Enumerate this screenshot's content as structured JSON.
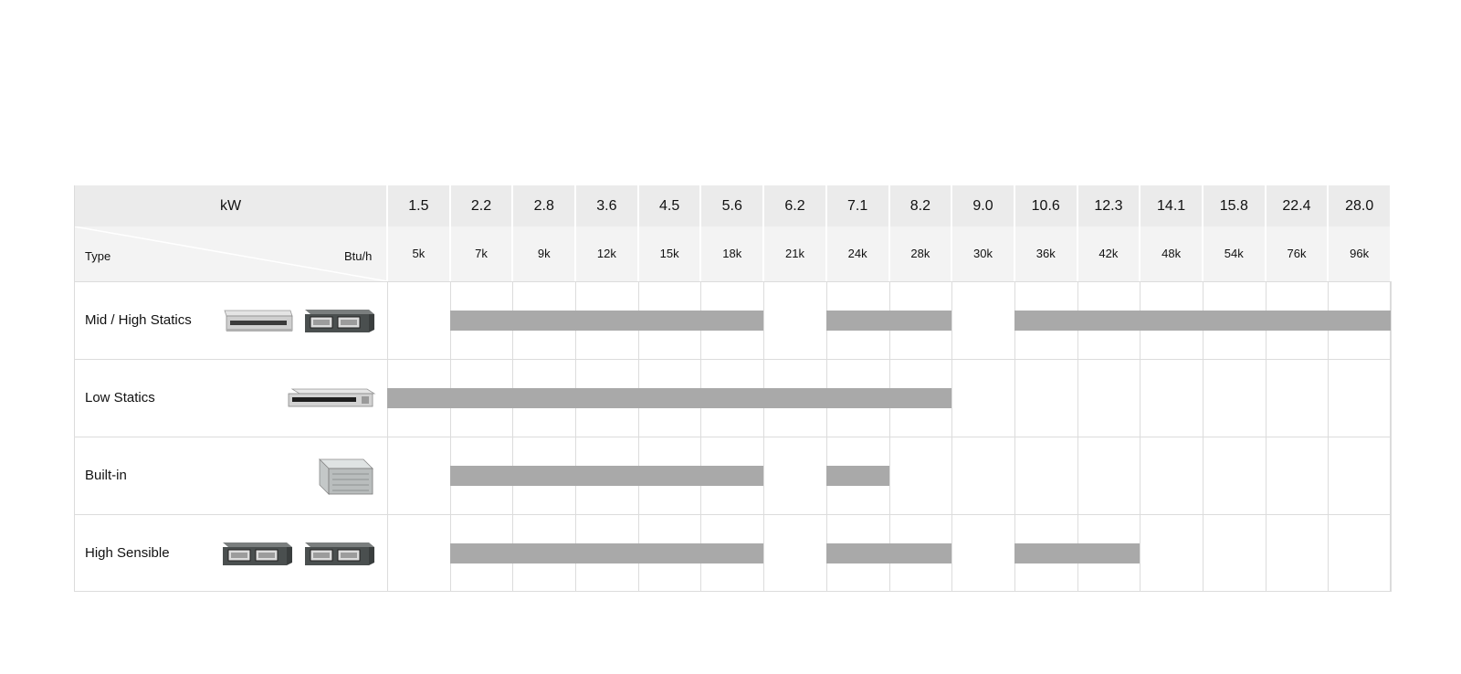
{
  "header": {
    "kw_label": "kW",
    "type_label": "Type",
    "btuh_label": "Btu/h"
  },
  "chart_data": {
    "type": "table",
    "columns_kw": [
      "1.5",
      "2.2",
      "2.8",
      "3.6",
      "4.5",
      "5.6",
      "6.2",
      "7.1",
      "8.2",
      "9.0",
      "10.6",
      "12.3",
      "14.1",
      "15.8",
      "22.4",
      "28.0"
    ],
    "columns_btuh": [
      "5k",
      "7k",
      "9k",
      "12k",
      "15k",
      "18k",
      "21k",
      "24k",
      "28k",
      "30k",
      "36k",
      "42k",
      "48k",
      "54k",
      "76k",
      "96k"
    ],
    "rows": [
      {
        "label": "Mid / High Statics",
        "units": [
          "slim-duct-unit-icon",
          "ducted-unit-icon"
        ],
        "available_kw": [
          [
            "2.2",
            "5.6"
          ],
          [
            "7.1",
            "8.2"
          ],
          [
            "10.6",
            "28.0"
          ]
        ]
      },
      {
        "label": "Low Statics",
        "units": [
          "low-static-duct-unit-icon"
        ],
        "available_kw": [
          [
            "1.5",
            "8.2"
          ]
        ]
      },
      {
        "label": "Built-in",
        "units": [
          "built-in-duct-unit-icon"
        ],
        "available_kw": [
          [
            "2.2",
            "5.6"
          ],
          [
            "7.1",
            "7.1"
          ]
        ]
      },
      {
        "label": "High Sensible",
        "units": [
          "ducted-unit-icon",
          "ducted-unit-icon"
        ],
        "available_kw": [
          [
            "2.2",
            "5.6"
          ],
          [
            "7.1",
            "8.2"
          ],
          [
            "10.6",
            "12.3"
          ]
        ]
      }
    ]
  },
  "colors": {
    "bar": "#a9a9a9",
    "header_top": "#ebebeb",
    "header_bottom": "#f3f3f3",
    "grid": "#dcdcdc"
  }
}
